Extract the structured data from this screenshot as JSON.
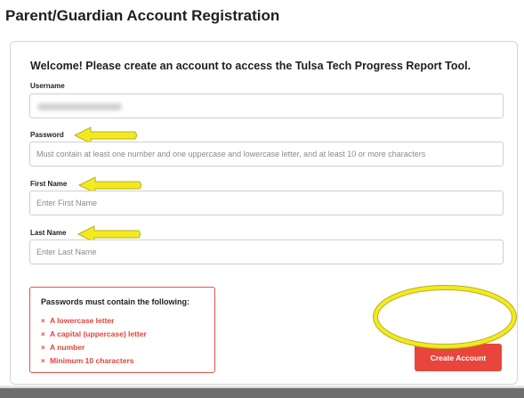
{
  "page_title": "Parent/Guardian Account Registration",
  "welcome_text": "Welcome! Please create an account to access the Tulsa Tech Progress Report Tool.",
  "form": {
    "username": {
      "label": "Username",
      "value_obscured": true
    },
    "password": {
      "label": "Password",
      "placeholder": "Must contain at least one number and one uppercase and lowercase letter, and at least 10 or more characters"
    },
    "first_name": {
      "label": "First Name",
      "placeholder": "Enter First Name"
    },
    "last_name": {
      "label": "Last Name",
      "placeholder": "Enter Last Name"
    }
  },
  "requirements": {
    "title": "Passwords must contain the following:",
    "marker": "×",
    "items": [
      "A lowercase letter",
      "A capital (uppercase) letter",
      "A number",
      "Minimum 10 characters"
    ]
  },
  "submit_label": "Create Account",
  "colors": {
    "accent_red": "#e8453c",
    "requirement_red": "#e0443a",
    "annotation_yellow": "#f2ea1f",
    "annotation_outline": "#b8b020"
  },
  "icons": {
    "annotation_arrow": "arrow-left-icon",
    "annotation_circle": "highlight-ellipse"
  }
}
